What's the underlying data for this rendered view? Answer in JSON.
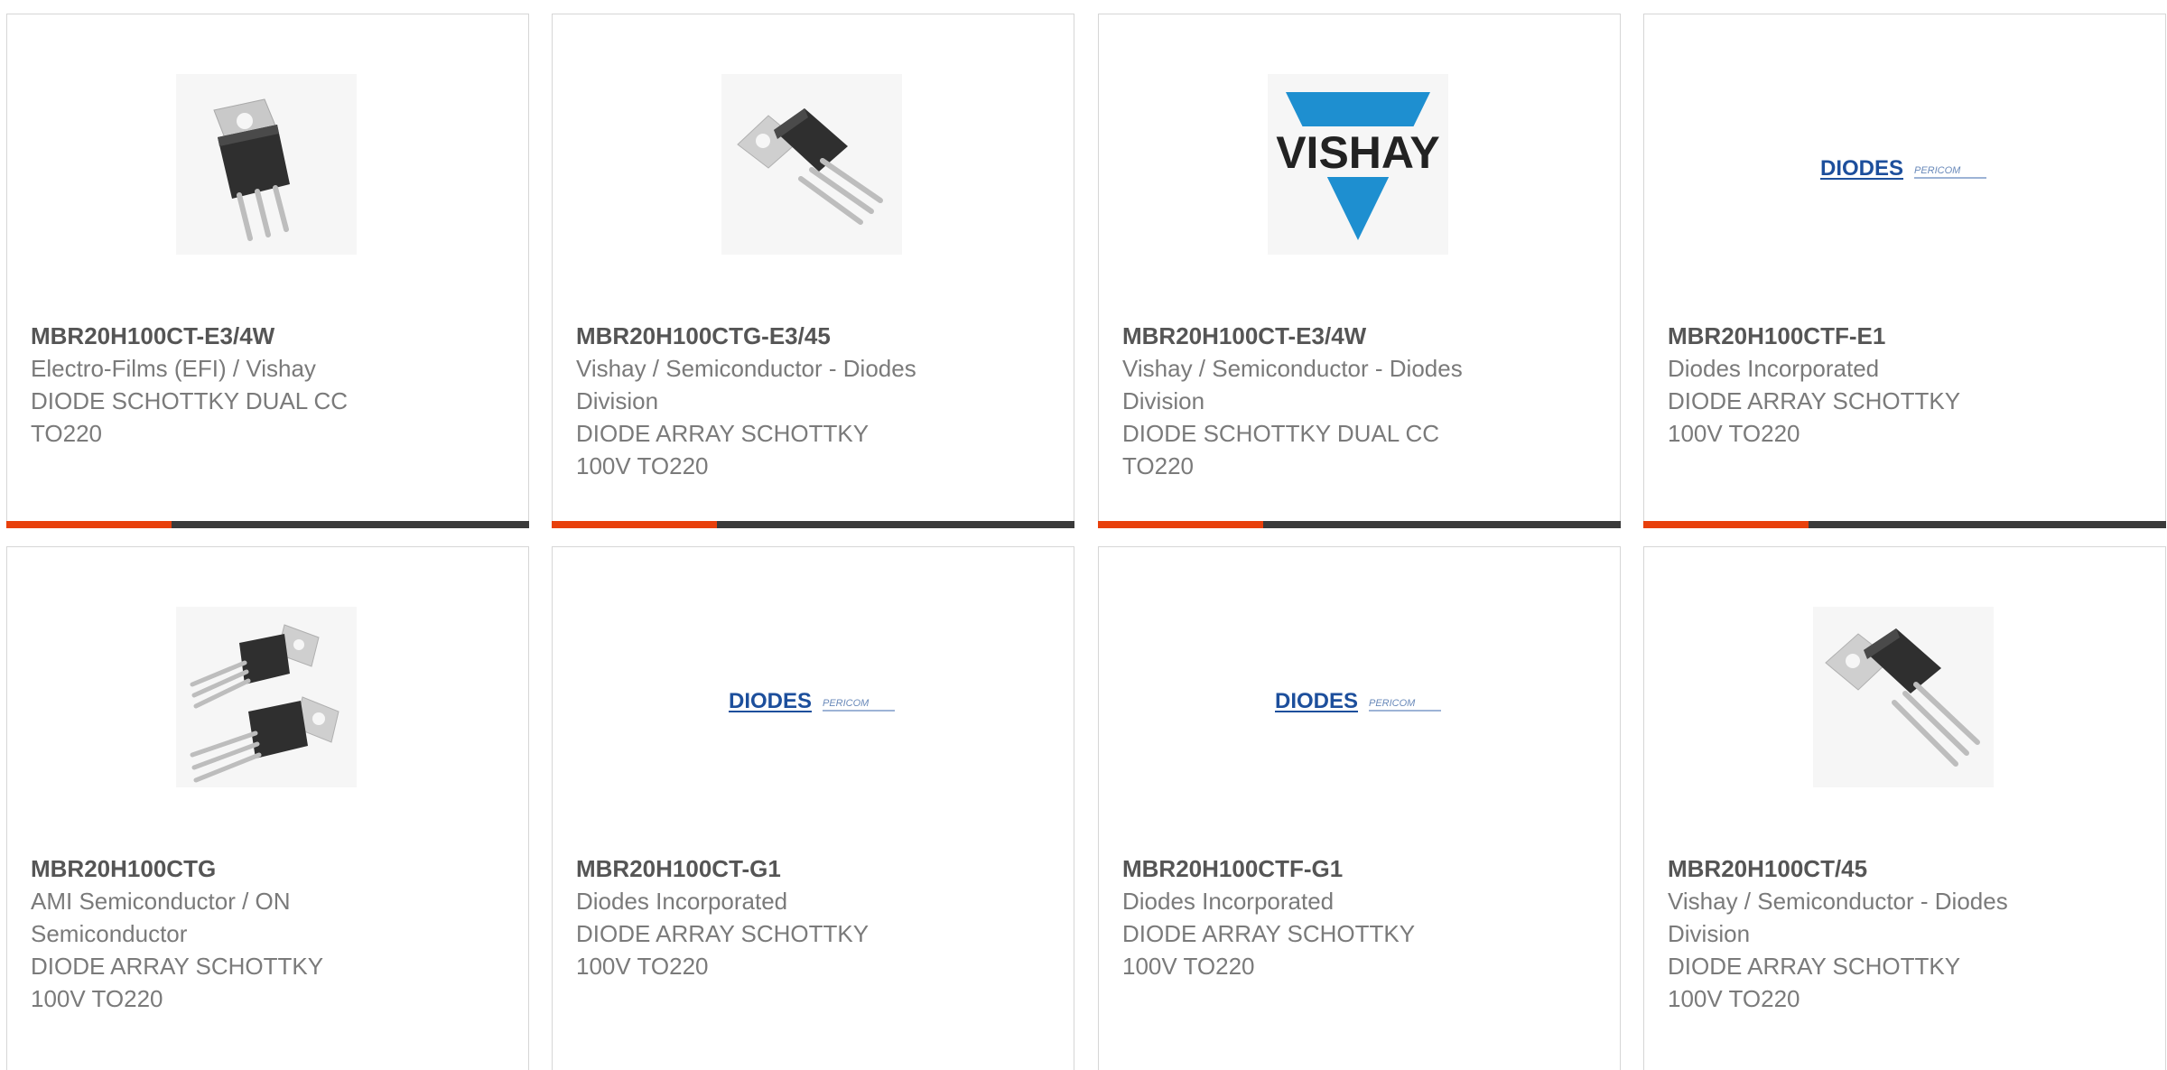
{
  "colors": {
    "accent": "#e8400c",
    "bar": "#3a3a3a",
    "vishay_blue": "#1e8fd0",
    "diodes_blue": "#1d4f9c"
  },
  "products": [
    {
      "part": "MBR20H100CT-E3/4W",
      "mfr_line1": "Electro-Films (EFI) / Vishay",
      "mfr_line2": "",
      "desc_line1": "DIODE SCHOTTKY DUAL CC",
      "desc_line2": "TO220",
      "image": "to220-single-icon",
      "bar": true
    },
    {
      "part": "MBR20H100CTG-E3/45",
      "mfr_line1": "Vishay / Semiconductor - Diodes",
      "mfr_line2": "Division",
      "desc_line1": "DIODE ARRAY SCHOTTKY",
      "desc_line2": "100V TO220",
      "image": "to220-angled-icon",
      "bar": true
    },
    {
      "part": "MBR20H100CT-E3/4W",
      "mfr_line1": "Vishay / Semiconductor - Diodes",
      "mfr_line2": "Division",
      "desc_line1": "DIODE SCHOTTKY DUAL CC",
      "desc_line2": "TO220",
      "image": "vishay-logo",
      "logo_text": "VISHAY",
      "bar": true
    },
    {
      "part": "MBR20H100CTF-E1",
      "mfr_line1": "Diodes Incorporated",
      "mfr_line2": "",
      "desc_line1": "DIODE ARRAY SCHOTTKY",
      "desc_line2": "100V TO220",
      "image": "diodes-pericom-logo",
      "logo_text": "DIODES",
      "logo_text2": "PERICOM",
      "bar": true
    },
    {
      "part": "MBR20H100CTG",
      "mfr_line1": "AMI Semiconductor / ON",
      "mfr_line2": "Semiconductor",
      "desc_line1": "DIODE ARRAY SCHOTTKY",
      "desc_line2": "100V TO220",
      "image": "to220-pair-icon",
      "bar": false
    },
    {
      "part": "MBR20H100CT-G1",
      "mfr_line1": "Diodes Incorporated",
      "mfr_line2": "",
      "desc_line1": "DIODE ARRAY SCHOTTKY",
      "desc_line2": "100V TO220",
      "image": "diodes-pericom-logo",
      "logo_text": "DIODES",
      "logo_text2": "PERICOM",
      "bar": false
    },
    {
      "part": "MBR20H100CTF-G1",
      "mfr_line1": "Diodes Incorporated",
      "mfr_line2": "",
      "desc_line1": "DIODE ARRAY SCHOTTKY",
      "desc_line2": "100V TO220",
      "image": "diodes-pericom-logo",
      "logo_text": "DIODES",
      "logo_text2": "PERICOM",
      "bar": false
    },
    {
      "part": "MBR20H100CT/45",
      "mfr_line1": "Vishay / Semiconductor - Diodes",
      "mfr_line2": "Division",
      "desc_line1": "DIODE ARRAY SCHOTTKY",
      "desc_line2": "100V TO220",
      "image": "to220-angled-icon",
      "bar": false
    }
  ]
}
